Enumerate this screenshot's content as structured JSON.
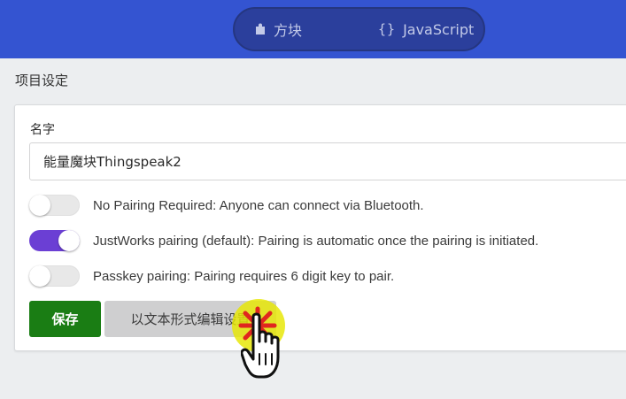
{
  "header": {
    "tabs": [
      {
        "label": "方块",
        "icon": "puzzle-piece-icon",
        "selected": false
      },
      {
        "label": "JavaScript",
        "icon": "braces-icon",
        "icon_text": "{}",
        "selected": false
      }
    ]
  },
  "settings": {
    "title": "项目设定",
    "name_label": "名字",
    "name_value": "能量魔块Thingspeak2",
    "pairing_options": [
      {
        "label": "No Pairing Required: Anyone can connect via Bluetooth.",
        "enabled": false
      },
      {
        "label": "JustWorks pairing (default): Pairing is automatic once the pairing is initiated.",
        "enabled": true
      },
      {
        "label": "Passkey pairing: Pairing requires 6 digit key to pair.",
        "enabled": false
      }
    ],
    "save_label": "保存",
    "edit_text_label": "以文本形式编辑设置"
  },
  "colors": {
    "header": "#3454d1",
    "toggle_on": "#6b3fd4",
    "save_button": "#1a7d14",
    "click_highlight": "#e6e600"
  }
}
